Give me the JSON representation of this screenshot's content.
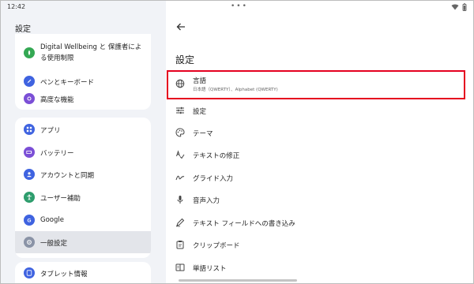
{
  "status": {
    "time": "12:42"
  },
  "left_pane": {
    "title": "設定",
    "items": [
      {
        "label": "Digital Wellbeing と 保護者による使用制限",
        "icon": "wellbeing-icon"
      },
      {
        "label": "ペンとキーボード",
        "icon": "pen-icon"
      },
      {
        "label": "高度な機能",
        "icon": "advanced-features-icon"
      },
      {
        "label": "アプリ",
        "icon": "apps-icon"
      },
      {
        "label": "バッテリー",
        "icon": "battery-icon"
      },
      {
        "label": "アカウントと同期",
        "icon": "account-icon"
      },
      {
        "label": "ユーザー補助",
        "icon": "accessibility-icon"
      },
      {
        "label": "Google",
        "icon": "google-icon"
      },
      {
        "label": "一般設定",
        "icon": "general-settings-icon",
        "selected": true
      },
      {
        "label": "タブレット情報",
        "icon": "tablet-info-icon"
      }
    ]
  },
  "right_pane": {
    "title": "設定",
    "items": [
      {
        "label": "言語",
        "sub": "日本語（QWERTY）、Alphabet (QWERTY)",
        "icon": "globe-icon",
        "highlighted": true
      },
      {
        "label": "設定",
        "icon": "tune-icon"
      },
      {
        "label": "テーマ",
        "icon": "palette-icon"
      },
      {
        "label": "テキストの修正",
        "icon": "spellcheck-icon"
      },
      {
        "label": "グライド入力",
        "icon": "gesture-icon"
      },
      {
        "label": "音声入力",
        "icon": "mic-icon"
      },
      {
        "label": "テキスト フィールドへの書き込み",
        "icon": "handwriting-icon"
      },
      {
        "label": "クリップボード",
        "icon": "clipboard-icon"
      },
      {
        "label": "単語リスト",
        "icon": "dictionary-icon"
      }
    ]
  },
  "colors": {
    "accent": "#3f63e0",
    "highlight": "#e5001f",
    "left_bg": "#f1f3f7"
  }
}
